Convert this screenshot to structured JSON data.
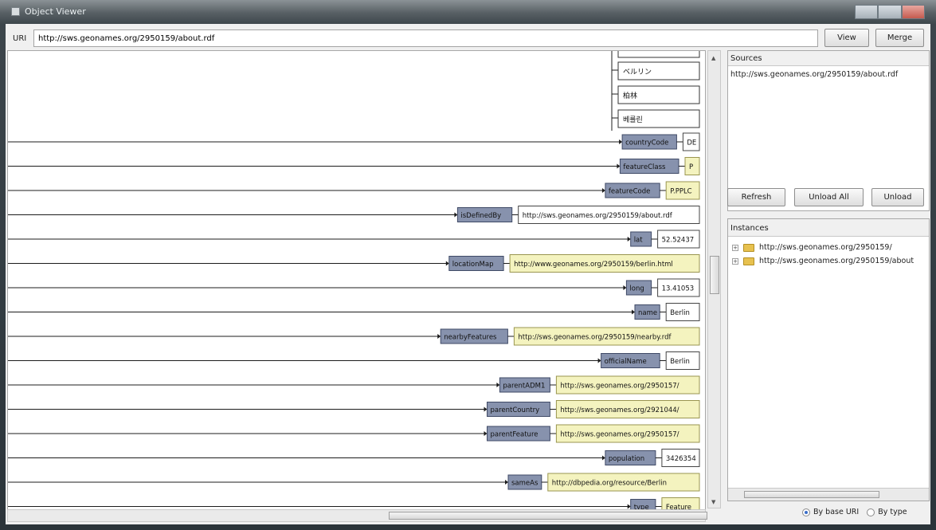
{
  "window": {
    "title": "Object Viewer"
  },
  "uri": {
    "label": "URI",
    "value": "http://sws.geonames.org/2950159/about.rdf"
  },
  "buttons": {
    "view": "View",
    "merge": "Merge",
    "refresh": "Refresh",
    "unload_all": "Unload All",
    "unload": "Unload"
  },
  "names_list": [
    "ベルリン",
    "柏林",
    "베를린"
  ],
  "properties": [
    {
      "name": "countryCode",
      "value": "DE",
      "type": "literal"
    },
    {
      "name": "featureClass",
      "value": "P",
      "type": "resource"
    },
    {
      "name": "featureCode",
      "value": "P.PPLC",
      "type": "resource"
    },
    {
      "name": "isDefinedBy",
      "value": "http://sws.geonames.org/2950159/about.rdf",
      "type": "literal"
    },
    {
      "name": "lat",
      "value": "52.52437",
      "type": "literal"
    },
    {
      "name": "locationMap",
      "value": "http://www.geonames.org/2950159/berlin.html",
      "type": "resource"
    },
    {
      "name": "long",
      "value": "13.41053",
      "type": "literal"
    },
    {
      "name": "name",
      "value": "Berlin",
      "type": "literal"
    },
    {
      "name": "nearbyFeatures",
      "value": "http://sws.geonames.org/2950159/nearby.rdf",
      "type": "resource"
    },
    {
      "name": "officialName",
      "value": "Berlin",
      "type": "literal"
    },
    {
      "name": "parentADM1",
      "value": "http://sws.geonames.org/2950157/",
      "type": "resource"
    },
    {
      "name": "parentCountry",
      "value": "http://sws.geonames.org/2921044/",
      "type": "resource"
    },
    {
      "name": "parentFeature",
      "value": "http://sws.geonames.org/2950157/",
      "type": "resource"
    },
    {
      "name": "population",
      "value": "3426354",
      "type": "literal"
    },
    {
      "name": "sameAs",
      "value": "http://dbpedia.org/resource/Berlin",
      "type": "resource"
    },
    {
      "name": "type",
      "value": "Feature",
      "type": "resource"
    }
  ],
  "sources": {
    "title": "Sources",
    "items": [
      "http://sws.geonames.org/2950159/about.rdf"
    ]
  },
  "instances": {
    "title": "Instances",
    "items": [
      "http://sws.geonames.org/2950159/",
      "http://sws.geonames.org/2950159/about"
    ]
  },
  "view_mode": {
    "options": [
      "By base URI",
      "By type"
    ],
    "selected": "By base URI"
  },
  "colors": {
    "property_box": "#8792ad",
    "resource_box": "#f4f3bf",
    "literal_box": "#ffffff",
    "edge": "#1c1c1c"
  }
}
